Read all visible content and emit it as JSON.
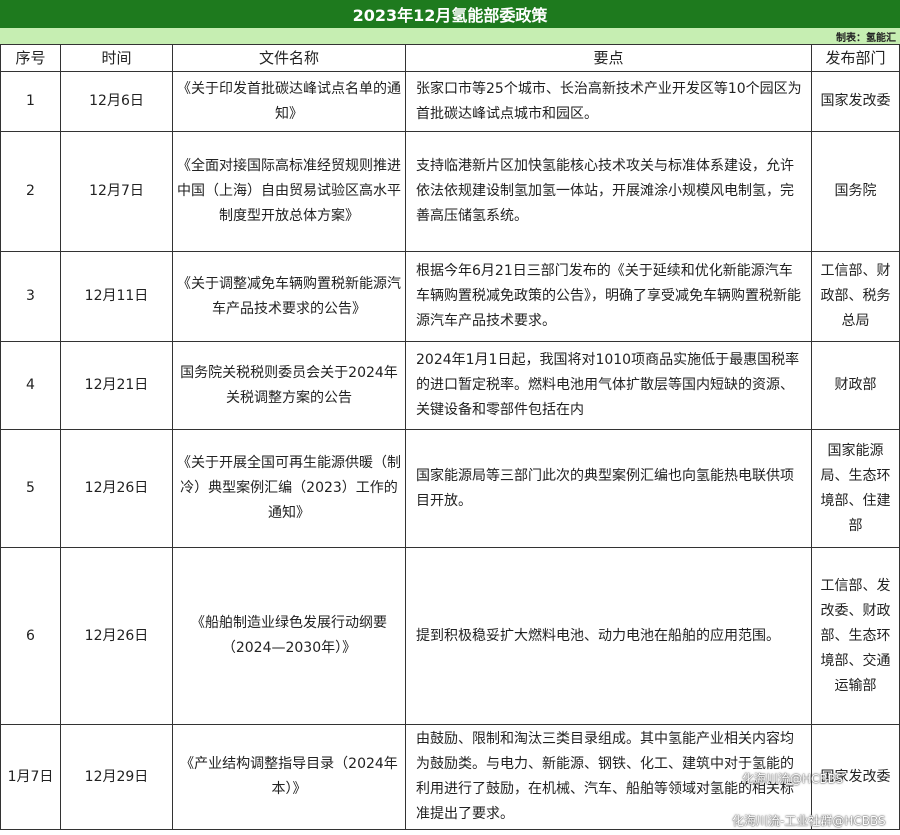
{
  "title": "2023年12月氢能部委政策",
  "maker": "制表：氢能汇",
  "headers": [
    "序号",
    "时间",
    "文件名称",
    "要点",
    "发布部门"
  ],
  "rows": [
    {
      "no": "1",
      "date": "12月6日",
      "name": "《关于印发首批碳达峰试点名单的通知》",
      "points": "张家口市等25个城市、长治高新技术产业开发区等10个园区为首批碳达峰试点城市和园区。",
      "dept": "国家发改委"
    },
    {
      "no": "2",
      "date": "12月7日",
      "name": "《全面对接国际高标准经贸规则推进中国（上海）自由贸易试验区高水平制度型开放总体方案》",
      "points": "支持临港新片区加快氢能核心技术攻关与标准体系建设，允许依法依规建设制氢加氢一体站，开展滩涂小规模风电制氢，完善高压储氢系统。",
      "dept": "国务院"
    },
    {
      "no": "3",
      "date": "12月11日",
      "name": "《关于调整减免车辆购置税新能源汽车产品技术要求的公告》",
      "points": "根据今年6月21日三部门发布的《关于延续和优化新能源汽车车辆购置税减免政策的公告》，明确了享受减免车辆购置税新能源汽车产品技术要求。",
      "dept": "工信部、财政部、税务总局"
    },
    {
      "no": "4",
      "date": "12月21日",
      "name": "国务院关税税则委员会关于2024年关税调整方案的公告",
      "points": "2024年1月1日起，我国将对1010项商品实施低于最惠国税率的进口暂定税率。燃料电池用气体扩散层等国内短缺的资源、关键设备和零部件包括在内",
      "dept": "财政部"
    },
    {
      "no": "5",
      "date": "12月26日",
      "name": "《关于开展全国可再生能源供暖（制冷）典型案例汇编（2023）工作的通知》",
      "points": "国家能源局等三部门此次的典型案例汇编也向氢能热电联供项目开放。",
      "dept": "国家能源局、生态环境部、住建部"
    },
    {
      "no": "6",
      "date": "12月26日",
      "name": "《船舶制造业绿色发展行动纲要（2024—2030年）》",
      "points": "提到积极稳妥扩大燃料电池、动力电池在船舶的应用范围。",
      "dept": "工信部、发改委、财政部、生态环境部、交通运输部"
    },
    {
      "no": "1月7日",
      "date": "12月29日",
      "name": "《产业结构调整指导目录（2024年本）》",
      "points": "由鼓励、限制和淘汰三类目录组成。其中氢能产业相关内容均为鼓励类。与电力、新能源、钢铁、化工、建筑中对于氢能的利用进行了鼓励，在机械、汽车、船舶等领域对氢能的相关标准提出了要求。",
      "dept": "国家发改委"
    }
  ],
  "watermarks": [
    "化海川流@HCBBS",
    "化海川流-工业社群@HCBBS"
  ]
}
